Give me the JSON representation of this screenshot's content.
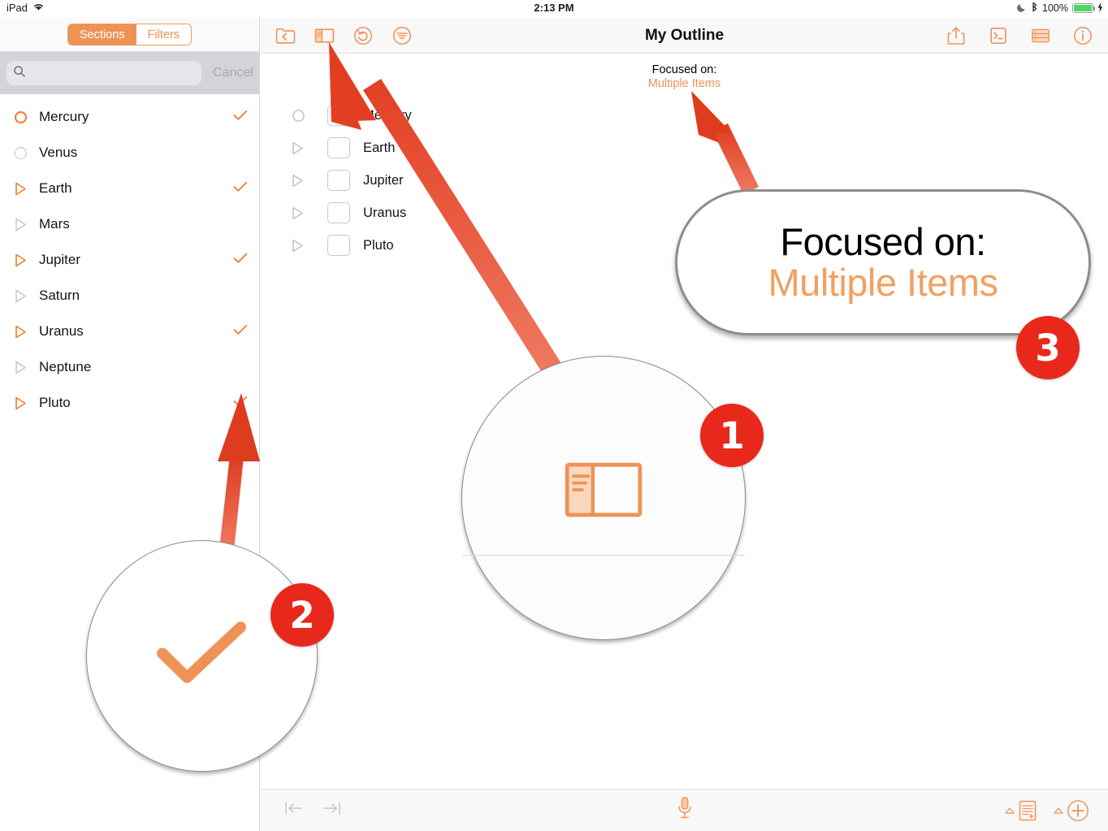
{
  "status_bar": {
    "device": "iPad",
    "wifi_icon": "wifi-icon",
    "time": "2:13 PM",
    "dnd_icon": "moon-icon",
    "bluetooth_icon": "bluetooth-icon",
    "battery_percent": "100%",
    "charging_icon": "lightning-bolt-icon"
  },
  "sidebar": {
    "segmented": {
      "options": [
        "Sections",
        "Filters"
      ],
      "selected": "Sections"
    },
    "search": {
      "value": "",
      "placeholder": "",
      "icon": "search-icon",
      "cancel_label": "Cancel"
    },
    "items": [
      {
        "label": "Mercury",
        "bullet": "circle",
        "bullet_state": "active",
        "checked": true
      },
      {
        "label": "Venus",
        "bullet": "circle",
        "bullet_state": "inactive",
        "checked": false
      },
      {
        "label": "Earth",
        "bullet": "triangle-right",
        "bullet_state": "active",
        "checked": true
      },
      {
        "label": "Mars",
        "bullet": "triangle-right",
        "bullet_state": "inactive",
        "checked": false
      },
      {
        "label": "Jupiter",
        "bullet": "triangle-right",
        "bullet_state": "active",
        "checked": true
      },
      {
        "label": "Saturn",
        "bullet": "triangle-right",
        "bullet_state": "inactive",
        "checked": false
      },
      {
        "label": "Uranus",
        "bullet": "triangle-right",
        "bullet_state": "active",
        "checked": true
      },
      {
        "label": "Neptune",
        "bullet": "triangle-right",
        "bullet_state": "inactive",
        "checked": false
      },
      {
        "label": "Pluto",
        "bullet": "triangle-right",
        "bullet_state": "active",
        "checked": true
      }
    ],
    "check_glyph": "✓"
  },
  "main": {
    "title": "My Outline",
    "toolbar_left": [
      {
        "name": "folder-back-icon",
        "label": "Documents"
      },
      {
        "name": "sidebar-toggle-icon",
        "label": "Sidebar"
      },
      {
        "name": "undo-icon",
        "label": "Undo"
      },
      {
        "name": "filter-icon",
        "label": "Filter"
      }
    ],
    "toolbar_right": [
      {
        "name": "share-icon",
        "label": "Share"
      },
      {
        "name": "script-icon",
        "label": "Automation"
      },
      {
        "name": "rows-icon",
        "label": "Columns"
      },
      {
        "name": "info-icon",
        "label": "Info"
      }
    ],
    "focus_banner": {
      "label": "Focused on:",
      "value": "Multiple Items"
    },
    "outline_rows": [
      {
        "label": "Mercury",
        "bullet": "circle",
        "checked": false
      },
      {
        "label": "Earth",
        "bullet": "triangle-right",
        "checked": false
      },
      {
        "label": "Jupiter",
        "bullet": "triangle-right",
        "checked": false
      },
      {
        "label": "Uranus",
        "bullet": "triangle-right",
        "checked": false
      },
      {
        "label": "Pluto",
        "bullet": "triangle-right",
        "checked": false
      }
    ],
    "bottom_bar": {
      "outdent_icon": "outdent-icon",
      "indent_icon": "indent-icon",
      "dictation_icon": "microphone-icon",
      "add_note_icon": "add-note-icon",
      "add_row_icon": "add-row-icon"
    }
  },
  "annotations": {
    "callouts": [
      {
        "number": "1",
        "target": "sidebar-toggle-icon",
        "zoom_content": "sidebar-toggle-icon"
      },
      {
        "number": "2",
        "target": "pluto-row-checkmark",
        "zoom_content": "checkmark-icon"
      },
      {
        "number": "3",
        "target": "focus-banner",
        "zoom_content": "focused-on-multiple-items"
      }
    ],
    "bubble": {
      "line1": "Focused on:",
      "line2": "Multiple Items"
    },
    "arrow_color": "#e8482e"
  },
  "colors": {
    "accent_orange": "#ef9256",
    "annotation_red": "#e8281a",
    "arrow_red": "#e8482e",
    "battery_green": "#4cd763",
    "search_bar_bg": "#d3d3d8",
    "toolbar_bg": "#f8f8f8"
  }
}
